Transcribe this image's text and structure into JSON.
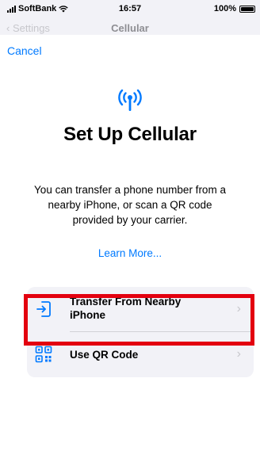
{
  "status_bar": {
    "carrier": "SoftBank",
    "time": "16:57",
    "battery": "100%"
  },
  "behind_header": {
    "back_label": "Settings",
    "title": "Cellular"
  },
  "sheet": {
    "cancel_label": "Cancel",
    "title": "Set Up Cellular",
    "description": "You can transfer a phone number from a nearby iPhone, or scan a QR code provided by your carrier.",
    "learn_more": "Learn More...",
    "options": [
      {
        "label": "Transfer From Nearby iPhone",
        "icon": "transfer-icon",
        "highlighted": false
      },
      {
        "label": "Use QR Code",
        "icon": "qr-code-icon",
        "highlighted": true
      }
    ]
  },
  "colors": {
    "accent": "#007aff",
    "highlight": "#e3000f",
    "group_bg": "#f2f2f7"
  }
}
